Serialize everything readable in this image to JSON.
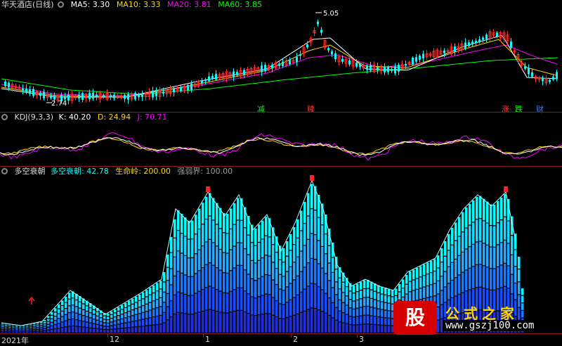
{
  "main_panel": {
    "title": "华天酒店(日线)",
    "ma": [
      {
        "label": "MA5: 3.30",
        "color": "#ffffff"
      },
      {
        "label": "MA10: 3.33",
        "color": "#ffd800"
      },
      {
        "label": "MA20: 3.81",
        "color": "#ff00ff"
      },
      {
        "label": "MA60: 3.85",
        "color": "#00ff00"
      }
    ],
    "high_label": "5.05",
    "low_label": "2.74",
    "signals": [
      {
        "text": "减",
        "color": "#00ff00"
      },
      {
        "text": "赎",
        "color": "#ff4040"
      },
      {
        "text": "涨",
        "color": "#ff4040"
      },
      {
        "text": "跌",
        "color": "#00ff00"
      },
      {
        "text": "财",
        "color": "#3a7cff"
      }
    ]
  },
  "kdj_panel": {
    "title": "KDJ(9,3,3)",
    "k_label": "K: 40.20",
    "d_label": "D: 24.94",
    "j_label": "J: 70.71"
  },
  "dk_panel": {
    "title": "多空衰朝",
    "value_label": "多空衰朝: 42.78",
    "life_label": "生命岭: 200.00",
    "strong_label": "强弱界: 100.00"
  },
  "x_axis": {
    "labels": [
      "2021年",
      "12",
      "1",
      "2",
      "3"
    ]
  },
  "watermark": {
    "logo_char": "股",
    "title": "公式之家",
    "url": "www.gszj100.com"
  },
  "colors": {
    "up": "#ff3030",
    "down": "#00ffff",
    "grid": "#8b1a1a"
  }
}
